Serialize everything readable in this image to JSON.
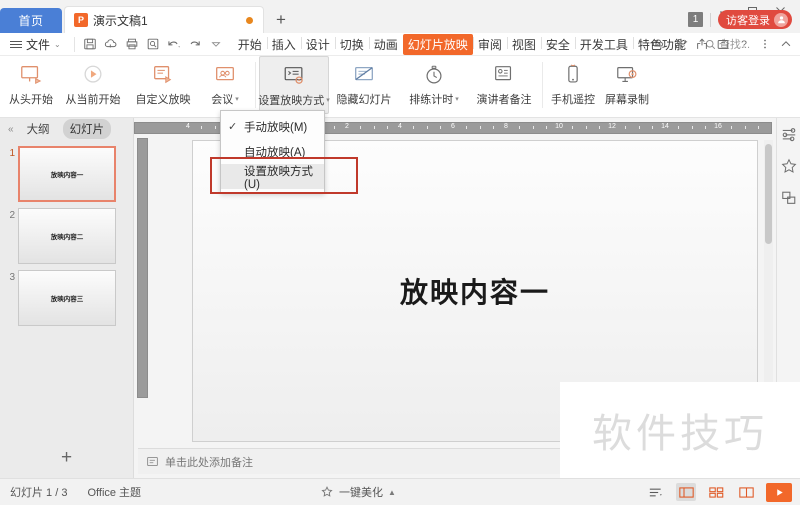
{
  "titlebar": {
    "home_tab": "首页",
    "doc_tab": "演示文稿1",
    "doc_icon_letter": "P",
    "new_tab": "+",
    "minimize": "—",
    "maximize": "▭",
    "close": "✕",
    "notify_count": "1",
    "guest_login": "访客登录"
  },
  "menubar": {
    "file": "文件",
    "quick_icons": [
      "save-icon",
      "cloud-sync-icon",
      "print-icon",
      "print-preview-icon",
      "undo-icon",
      "redo-icon",
      "customize-icon"
    ],
    "tabs": [
      {
        "label": "开始",
        "active": false
      },
      {
        "label": "插入",
        "active": false
      },
      {
        "label": "设计",
        "active": false
      },
      {
        "label": "切换",
        "active": false
      },
      {
        "label": "动画",
        "active": false
      },
      {
        "label": "幻灯片放映",
        "active": true
      },
      {
        "label": "审阅",
        "active": false
      },
      {
        "label": "视图",
        "active": false
      },
      {
        "label": "安全",
        "active": false
      },
      {
        "label": "开发工具",
        "active": false
      },
      {
        "label": "特色功能",
        "active": false
      }
    ],
    "search_placeholder": "查找...",
    "right_icons": [
      "cloud-icon",
      "add-collaborator-icon",
      "share-icon",
      "feedback-icon",
      "help-icon",
      "more-icon",
      "collapse-ribbon-icon"
    ]
  },
  "ribbon": {
    "buttons": [
      {
        "label": "从头开始",
        "icon": "present-from-start-icon",
        "dropdown": false,
        "pressed": false
      },
      {
        "label": "从当前开始",
        "icon": "present-from-current-icon",
        "dropdown": false,
        "pressed": false
      },
      {
        "label": "自定义放映",
        "icon": "custom-show-icon",
        "dropdown": false,
        "pressed": false
      },
      {
        "label": "会议",
        "icon": "meeting-icon",
        "dropdown": true,
        "pressed": false
      },
      {
        "label": "设置放映方式",
        "icon": "setup-show-icon",
        "dropdown": true,
        "pressed": true
      },
      {
        "label": "隐藏幻灯片",
        "icon": "hide-slide-icon",
        "dropdown": false,
        "pressed": false
      },
      {
        "label": "排练计时",
        "icon": "rehearse-timing-icon",
        "dropdown": true,
        "pressed": false
      },
      {
        "label": "演讲者备注",
        "icon": "presenter-notes-icon",
        "dropdown": false,
        "pressed": false
      },
      {
        "label": "手机遥控",
        "icon": "phone-remote-icon",
        "dropdown": false,
        "pressed": false
      },
      {
        "label": "屏幕录制",
        "icon": "screen-record-icon",
        "dropdown": false,
        "pressed": false
      }
    ]
  },
  "dropdown": {
    "items": [
      {
        "label": "手动放映(M)",
        "checked": true,
        "highlighted": false
      },
      {
        "label": "自动放映(A)",
        "checked": false,
        "highlighted": false
      },
      {
        "label": "设置放映方式(U)",
        "checked": false,
        "highlighted": true
      }
    ],
    "annotation_color": "#c0392b"
  },
  "sidebar": {
    "collapse_icon": "collapse-left-icon",
    "tab_outline": "大纲",
    "tab_slides": "幻灯片",
    "active_tab": "幻灯片",
    "add_slide": "+",
    "slides": [
      {
        "num": "1",
        "text": "放映内容一",
        "selected": true
      },
      {
        "num": "2",
        "text": "放映内容二",
        "selected": false
      },
      {
        "num": "3",
        "text": "放映内容三",
        "selected": false
      }
    ]
  },
  "editor": {
    "slide_title": "放映内容一",
    "notes_placeholder": "单击此处添加备注",
    "ruler_numbers": [
      "4",
      "2",
      "0",
      "2",
      "4",
      "6",
      "8",
      "10",
      "12",
      "14",
      "16"
    ]
  },
  "rightbar": {
    "icons": [
      "properties-panel-icon",
      "design-ideas-icon",
      "layers-panel-icon"
    ]
  },
  "statusbar": {
    "slide_count": "幻灯片 1 / 3",
    "theme": "Office 主题",
    "beautify": "一键美化",
    "view_icons": [
      "outline-view-icon",
      "normal-view-icon",
      "slide-sorter-icon",
      "reading-view-icon"
    ],
    "play_label": "▶"
  },
  "watermark": {
    "text": "软件技巧"
  },
  "colors": {
    "accent_orange": "#f2682a",
    "home_blue": "#4a7fd6",
    "guest_red": "#e04a3f",
    "annotation_red": "#c0392b",
    "selected_thumb": "#e8836b"
  }
}
